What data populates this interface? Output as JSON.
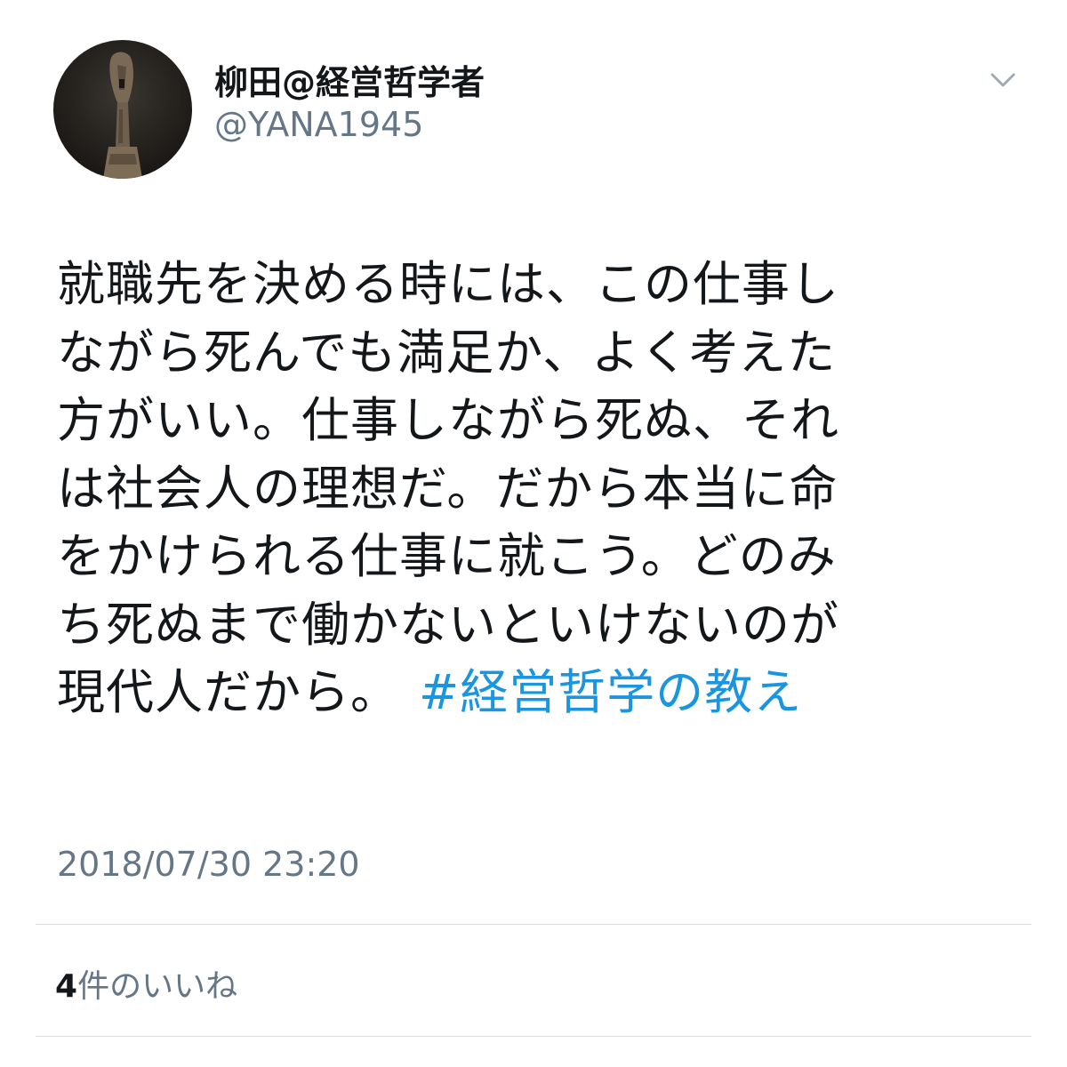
{
  "user": {
    "display_name": "柳田@経営哲学者",
    "handle": "@YANA1945"
  },
  "tweet": {
    "lines": [
      "就職先を決める時には、この仕事し",
      "ながら死んでも満足か、よく考えた",
      "方がいい。仕事しながら死ぬ、それ",
      "は社会人の理想だ。だから本当に命",
      "をかけられる仕事に就こう。どのみ",
      "ち死ぬまで働かないといけないのが",
      "現代人だから。"
    ],
    "hashtag": "#経営哲学の教え",
    "timestamp": "2018/07/30 23:20"
  },
  "engagement": {
    "likes_count": "4",
    "likes_label": "件のいいね"
  },
  "icons": {
    "menu": "chevron-down-icon"
  },
  "colors": {
    "hashtag": "#1b95e0",
    "secondary_text": "#657786",
    "primary_text": "#14171a",
    "divider": "#d8dde1"
  }
}
